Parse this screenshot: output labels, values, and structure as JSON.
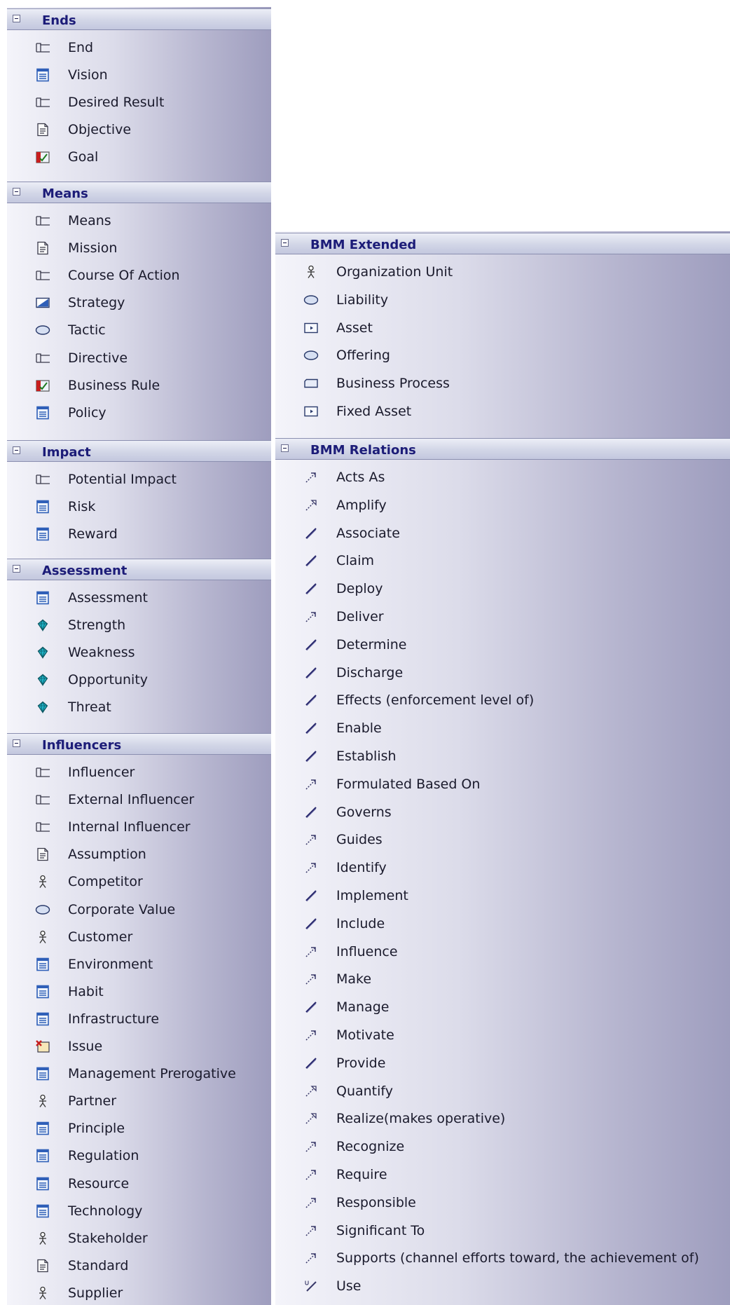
{
  "colors": {
    "header_text": "#1c1c78",
    "item_text": "#1a1a2c",
    "panel_gradient_start": "#f4f4fa",
    "panel_gradient_end": "#9e9dbe",
    "icon_blue": "#2f5fb8",
    "icon_red": "#c81e1e",
    "icon_teal": "#1fb5c9"
  },
  "left_panel": {
    "sections": [
      {
        "title": "Ends",
        "items": [
          {
            "label": "End",
            "icon": "tab-icon"
          },
          {
            "label": "Vision",
            "icon": "document-icon"
          },
          {
            "label": "Desired Result",
            "icon": "tab-icon"
          },
          {
            "label": "Objective",
            "icon": "note-icon"
          },
          {
            "label": "Goal",
            "icon": "chart-icon"
          }
        ]
      },
      {
        "title": "Means",
        "items": [
          {
            "label": "Means",
            "icon": "tab-icon"
          },
          {
            "label": "Mission",
            "icon": "note-icon"
          },
          {
            "label": "Course Of Action",
            "icon": "tab-icon"
          },
          {
            "label": "Strategy",
            "icon": "strategy-icon"
          },
          {
            "label": "Tactic",
            "icon": "ellipse-icon"
          },
          {
            "label": "Directive",
            "icon": "tab-icon"
          },
          {
            "label": "Business Rule",
            "icon": "chart-icon"
          },
          {
            "label": "Policy",
            "icon": "document-icon"
          }
        ]
      },
      {
        "title": "Impact",
        "items": [
          {
            "label": "Potential Impact",
            "icon": "tab-icon"
          },
          {
            "label": "Risk",
            "icon": "document-icon"
          },
          {
            "label": "Reward",
            "icon": "document-icon"
          }
        ]
      },
      {
        "title": "Assessment",
        "items": [
          {
            "label": "Assessment",
            "icon": "document-icon"
          },
          {
            "label": "Strength",
            "icon": "gem-icon"
          },
          {
            "label": "Weakness",
            "icon": "gem-icon"
          },
          {
            "label": "Opportunity",
            "icon": "gem-icon"
          },
          {
            "label": "Threat",
            "icon": "gem-icon"
          }
        ]
      },
      {
        "title": "Influencers",
        "items": [
          {
            "label": "Influencer",
            "icon": "tab-icon"
          },
          {
            "label": "External Influencer",
            "icon": "tab-icon"
          },
          {
            "label": "Internal Influencer",
            "icon": "tab-icon"
          },
          {
            "label": "Assumption",
            "icon": "note-icon"
          },
          {
            "label": "Competitor",
            "icon": "actor-icon"
          },
          {
            "label": "Corporate Value",
            "icon": "ellipse-icon"
          },
          {
            "label": "Customer",
            "icon": "actor-icon"
          },
          {
            "label": "Environment",
            "icon": "document-icon"
          },
          {
            "label": "Habit",
            "icon": "document-icon"
          },
          {
            "label": "Infrastructure",
            "icon": "document-icon"
          },
          {
            "label": "Issue",
            "icon": "issue-icon"
          },
          {
            "label": "Management Prerogative",
            "icon": "document-icon"
          },
          {
            "label": "Partner",
            "icon": "actor-icon"
          },
          {
            "label": "Principle",
            "icon": "document-icon"
          },
          {
            "label": "Regulation",
            "icon": "document-icon"
          },
          {
            "label": "Resource",
            "icon": "document-icon"
          },
          {
            "label": "Technology",
            "icon": "document-icon"
          },
          {
            "label": "Stakeholder",
            "icon": "actor-icon"
          },
          {
            "label": "Standard",
            "icon": "note-icon"
          },
          {
            "label": "Supplier",
            "icon": "actor-icon"
          }
        ]
      }
    ]
  },
  "right_panel": {
    "sections": [
      {
        "title": "BMM Extended",
        "items": [
          {
            "label": "Organization Unit",
            "icon": "actor-icon"
          },
          {
            "label": "Liability",
            "icon": "ellipse-icon"
          },
          {
            "label": "Asset",
            "icon": "asset-icon"
          },
          {
            "label": "Offering",
            "icon": "ellipse-icon"
          },
          {
            "label": "Business Process",
            "icon": "process-icon"
          },
          {
            "label": "Fixed Asset",
            "icon": "asset-icon"
          }
        ]
      },
      {
        "title": "BMM Relations",
        "items": [
          {
            "label": "Acts As",
            "icon": "dependency-icon"
          },
          {
            "label": "Amplify",
            "icon": "realize-icon"
          },
          {
            "label": "Associate",
            "icon": "association-icon"
          },
          {
            "label": "Claim",
            "icon": "association-icon"
          },
          {
            "label": "Deploy",
            "icon": "association-icon"
          },
          {
            "label": "Deliver",
            "icon": "dependency-icon"
          },
          {
            "label": "Determine",
            "icon": "association-icon"
          },
          {
            "label": "Discharge",
            "icon": "association-icon"
          },
          {
            "label": "Effects (enforcement level of)",
            "icon": "association-icon"
          },
          {
            "label": "Enable",
            "icon": "association-icon"
          },
          {
            "label": "Establish",
            "icon": "association-icon"
          },
          {
            "label": "Formulated Based On",
            "icon": "dependency-icon"
          },
          {
            "label": "Governs",
            "icon": "association-icon"
          },
          {
            "label": "Guides",
            "icon": "dependency-icon"
          },
          {
            "label": "Identify",
            "icon": "dependency-icon"
          },
          {
            "label": "Implement",
            "icon": "association-icon"
          },
          {
            "label": "Include",
            "icon": "association-icon"
          },
          {
            "label": "Influence",
            "icon": "dependency-icon"
          },
          {
            "label": "Make",
            "icon": "dependency-icon"
          },
          {
            "label": "Manage",
            "icon": "association-icon"
          },
          {
            "label": "Motivate",
            "icon": "dependency-icon"
          },
          {
            "label": "Provide",
            "icon": "association-icon"
          },
          {
            "label": "Quantify",
            "icon": "realize-icon"
          },
          {
            "label": "Realize(makes operative)",
            "icon": "realize-icon"
          },
          {
            "label": "Recognize",
            "icon": "dependency-icon"
          },
          {
            "label": "Require",
            "icon": "dependency-icon"
          },
          {
            "label": "Responsible",
            "icon": "dependency-icon"
          },
          {
            "label": "Significant To",
            "icon": "dependency-icon"
          },
          {
            "label": "Supports (channel efforts toward, the achievement of)",
            "icon": "dependency-icon"
          },
          {
            "label": "Use",
            "icon": "use-icon"
          }
        ]
      }
    ]
  }
}
